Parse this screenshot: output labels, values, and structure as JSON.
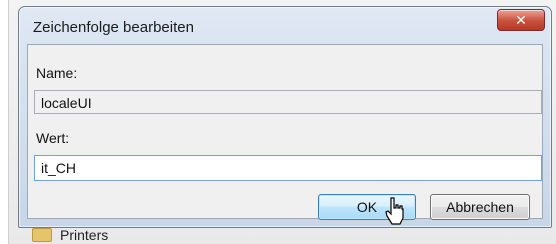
{
  "background": {
    "bottom_item_label": "Printers"
  },
  "dialog": {
    "title": "Zeichenfolge bearbeiten",
    "close_icon": "close-icon",
    "name_label": "Name:",
    "name_value": "localeUI",
    "value_label": "Wert:",
    "value_input": "it_CH",
    "ok_label": "OK",
    "cancel_label": "Abbrechen"
  },
  "colors": {
    "close_button": "#c9503c",
    "ok_border": "#3c7fb1",
    "input_border": "#6fa4d9"
  }
}
